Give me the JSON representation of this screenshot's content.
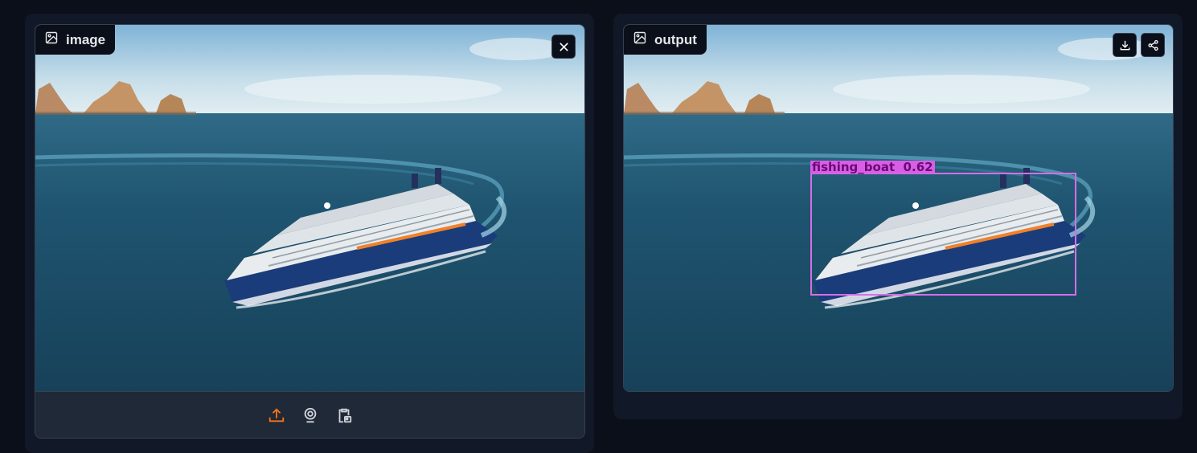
{
  "input_panel": {
    "label": "image",
    "label_icon": "image-icon",
    "clear_icon": "close-icon",
    "sources": [
      {
        "name": "upload-icon",
        "color": "#f97316"
      },
      {
        "name": "webcam-icon",
        "color": "#d1d5db"
      },
      {
        "name": "clipboard-icon",
        "color": "#d1d5db"
      }
    ]
  },
  "output_panel": {
    "label": "output",
    "label_icon": "image-icon",
    "download_icon": "download-icon",
    "share_icon": "share-icon",
    "detections": [
      {
        "label": "fishing_boat",
        "score": "0.62",
        "display": "fishing_boat  0.62",
        "color": "#d95ee6"
      }
    ]
  },
  "colors": {
    "page_background": "#0b0f19",
    "block_background": "#111827",
    "border": "#374151",
    "accent": "#f97316",
    "sky": "#cfe3ee",
    "sea": "#1f4e66"
  }
}
